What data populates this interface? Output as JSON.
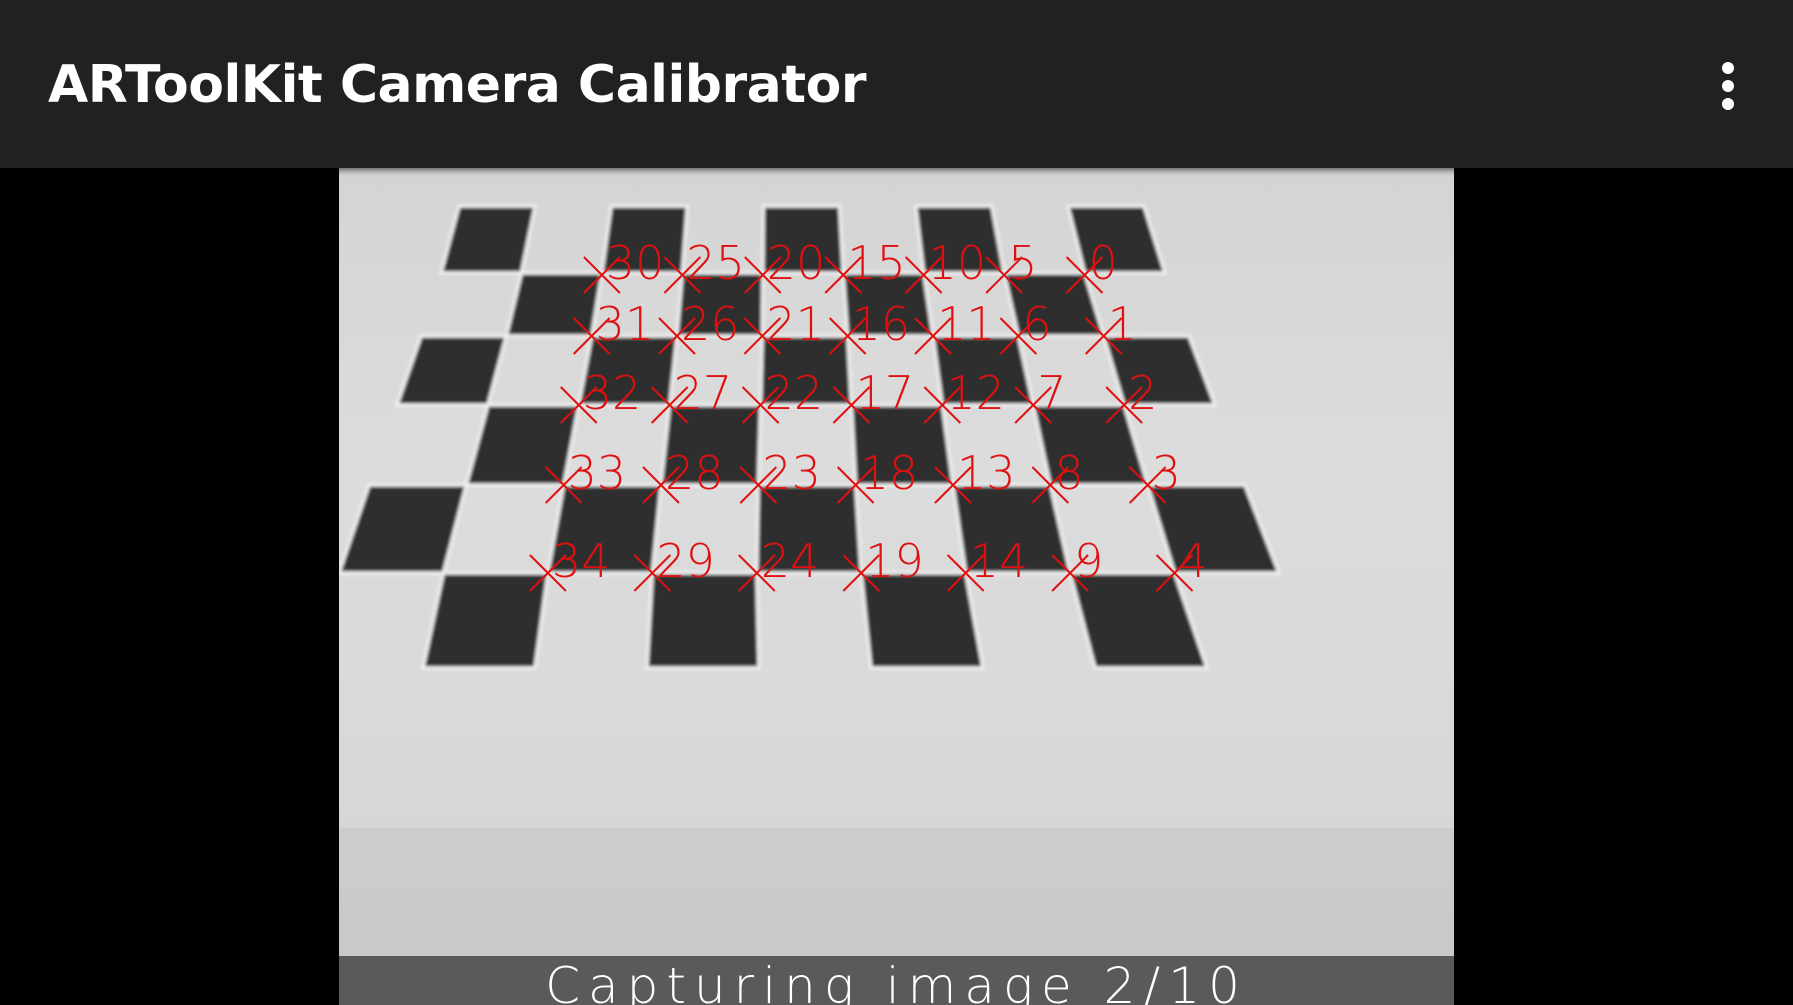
{
  "app_bar": {
    "title": "ARToolKit Camera Calibrator",
    "menu_icon": "overflow-menu-icon",
    "background": "#212121"
  },
  "camera_view": {
    "marker_color": "#e01010",
    "corner_labels": [
      "0",
      "1",
      "2",
      "3",
      "4",
      "5",
      "6",
      "7",
      "8",
      "9",
      "10",
      "11",
      "12",
      "13",
      "14",
      "15",
      "16",
      "17",
      "18",
      "19",
      "20",
      "21",
      "22",
      "23",
      "24",
      "25",
      "26",
      "27",
      "28",
      "29",
      "30",
      "31",
      "32",
      "33",
      "34"
    ]
  },
  "status": {
    "text": "Capturing image 2/10"
  }
}
